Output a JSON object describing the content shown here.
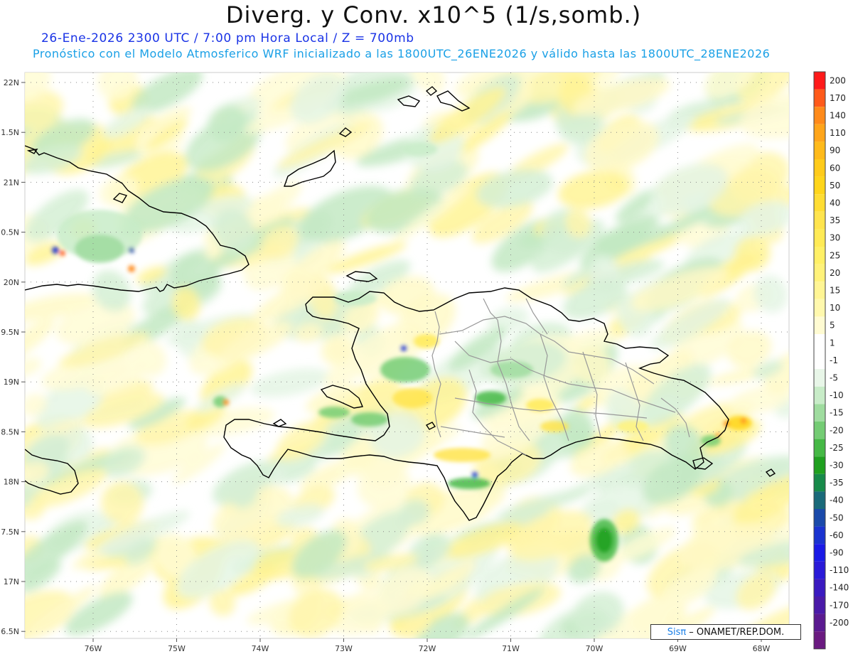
{
  "header": {
    "title": "Diverg. y Conv. x10^5 (1/s,somb.)",
    "line1": "26-Ene-2026  2300 UTC / 7:00 pm Hora Local / Z = 700mb",
    "line2": "Pronóstico con el Modelo Atmosferico WRF inicializado a las 1800UTC_26ENE2026 y válido hasta las  1800UTC_28ENE2026"
  },
  "map": {
    "lat_labels": [
      "22N",
      "1.5N",
      "21N",
      "0.5N",
      "20N",
      "9.5N",
      "19N",
      "8.5N",
      "18N",
      "7.5N",
      "17N",
      "6.5N"
    ],
    "lon_labels": [
      "76W",
      "75W",
      "74W",
      "73W",
      "72W",
      "71W",
      "70W",
      "69W",
      "68W"
    ],
    "colors": {
      "ocean_base": "#ffffff",
      "coast": "#000000",
      "provinces": "#999999",
      "gridlines": "#777777"
    }
  },
  "legend": {
    "levels": [
      {
        "label": "200",
        "color": "#ff1a1a"
      },
      {
        "label": "170",
        "color": "#ff5a1a"
      },
      {
        "label": "140",
        "color": "#ff8a1a"
      },
      {
        "label": "110",
        "color": "#ffa51a"
      },
      {
        "label": "90",
        "color": "#ffba1a"
      },
      {
        "label": "60",
        "color": "#ffcb1a"
      },
      {
        "label": "50",
        "color": "#ffd51a"
      },
      {
        "label": "40",
        "color": "#ffdd33"
      },
      {
        "label": "35",
        "color": "#ffe44d"
      },
      {
        "label": "30",
        "color": "#ffea55"
      },
      {
        "label": "25",
        "color": "#fff066"
      },
      {
        "label": "20",
        "color": "#fff27a"
      },
      {
        "label": "15",
        "color": "#fff594"
      },
      {
        "label": "10",
        "color": "#fff8ad"
      },
      {
        "label": "5",
        "color": "#fffbd2"
      },
      {
        "label": "1",
        "color": "#ffffff"
      },
      {
        "label": "-1",
        "color": "#ffffff"
      },
      {
        "label": "-5",
        "color": "#e8f6e8"
      },
      {
        "label": "-10",
        "color": "#c8ecc8"
      },
      {
        "label": "-15",
        "color": "#9fdc9f"
      },
      {
        "label": "-20",
        "color": "#74cc74"
      },
      {
        "label": "-25",
        "color": "#45b845"
      },
      {
        "label": "-30",
        "color": "#1fa01f"
      },
      {
        "label": "-35",
        "color": "#178a4a"
      },
      {
        "label": "-40",
        "color": "#1a6a7a"
      },
      {
        "label": "-50",
        "color": "#1a4aaa"
      },
      {
        "label": "-60",
        "color": "#1a33d0"
      },
      {
        "label": "-90",
        "color": "#1a1ae6"
      },
      {
        "label": "-110",
        "color": "#2a1ad8"
      },
      {
        "label": "-140",
        "color": "#3a1ac0"
      },
      {
        "label": "-170",
        "color": "#4a1aa8"
      },
      {
        "label": "-200",
        "color": "#5a1a90"
      },
      {
        "label": "",
        "color": "#6a1a80"
      }
    ]
  },
  "credit": {
    "logo": "Sisπ",
    "text": "– ONAMET/REP.DOM."
  }
}
